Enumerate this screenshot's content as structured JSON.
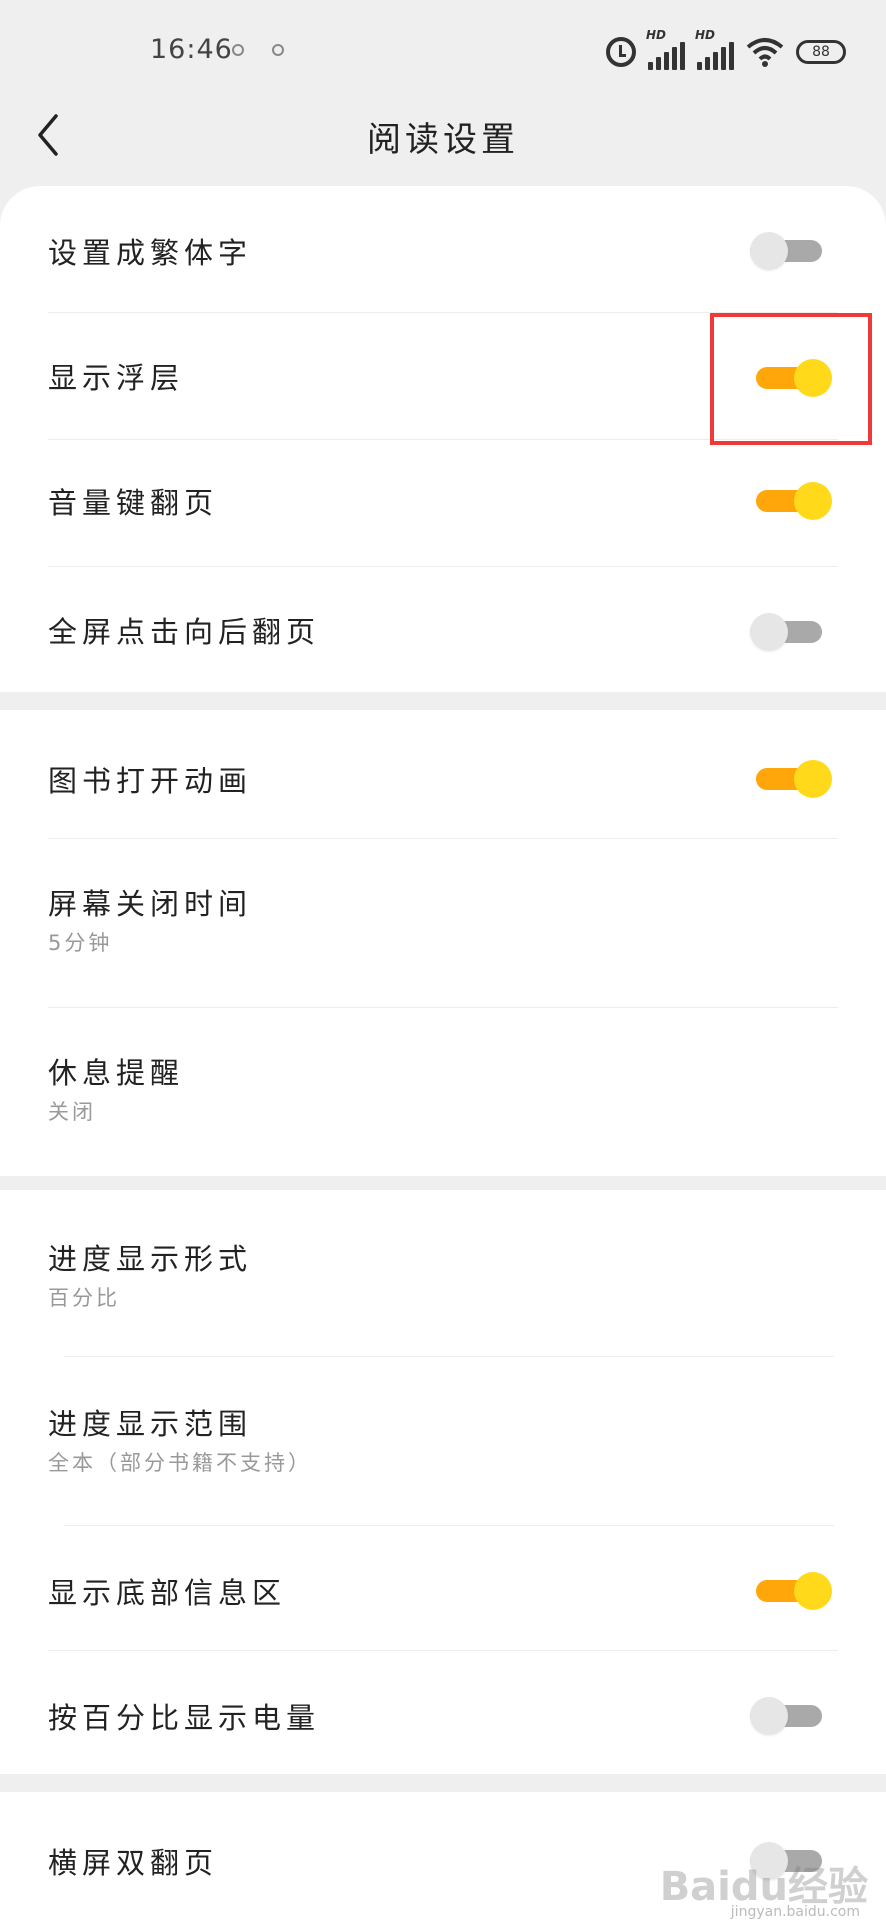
{
  "status_bar": {
    "time": "16:46",
    "network_label": "HD",
    "battery": "88",
    "icons": [
      "alarm-icon",
      "signal-icon",
      "signal-icon",
      "wifi-icon",
      "battery-icon"
    ]
  },
  "header": {
    "title": "阅读设置",
    "back_icon": "chevron-left-icon"
  },
  "sections": [
    {
      "items": [
        {
          "title": "设置成繁体字",
          "switch": false
        },
        {
          "title": "显示浮层",
          "switch": true
        },
        {
          "title": "音量键翻页",
          "switch": true
        },
        {
          "title": "全屏点击向后翻页",
          "switch": false
        }
      ]
    },
    {
      "items": [
        {
          "title": "图书打开动画",
          "switch": true
        },
        {
          "title": "屏幕关闭时间",
          "subtitle": "5分钟"
        },
        {
          "title": "休息提醒",
          "subtitle": "关闭"
        }
      ]
    },
    {
      "items": [
        {
          "title": "进度显示形式",
          "subtitle": "百分比"
        },
        {
          "title": "进度显示范围",
          "subtitle": "全本（部分书籍不支持）"
        },
        {
          "title": "显示底部信息区",
          "switch": true
        },
        {
          "title": "按百分比显示电量",
          "switch": false
        }
      ]
    },
    {
      "items": [
        {
          "title": "横屏双翻页",
          "switch": false
        }
      ]
    }
  ],
  "colors": {
    "switch_on_track": "#ffa60b",
    "switch_on_knob": "#ffd91a",
    "switch_off_track": "#a9a9a9",
    "switch_off_knob": "#e6e6e6",
    "highlight": "#f03a3a"
  },
  "watermark": {
    "text": "Baidu经验",
    "sub": "jingyan.baidu.com"
  }
}
